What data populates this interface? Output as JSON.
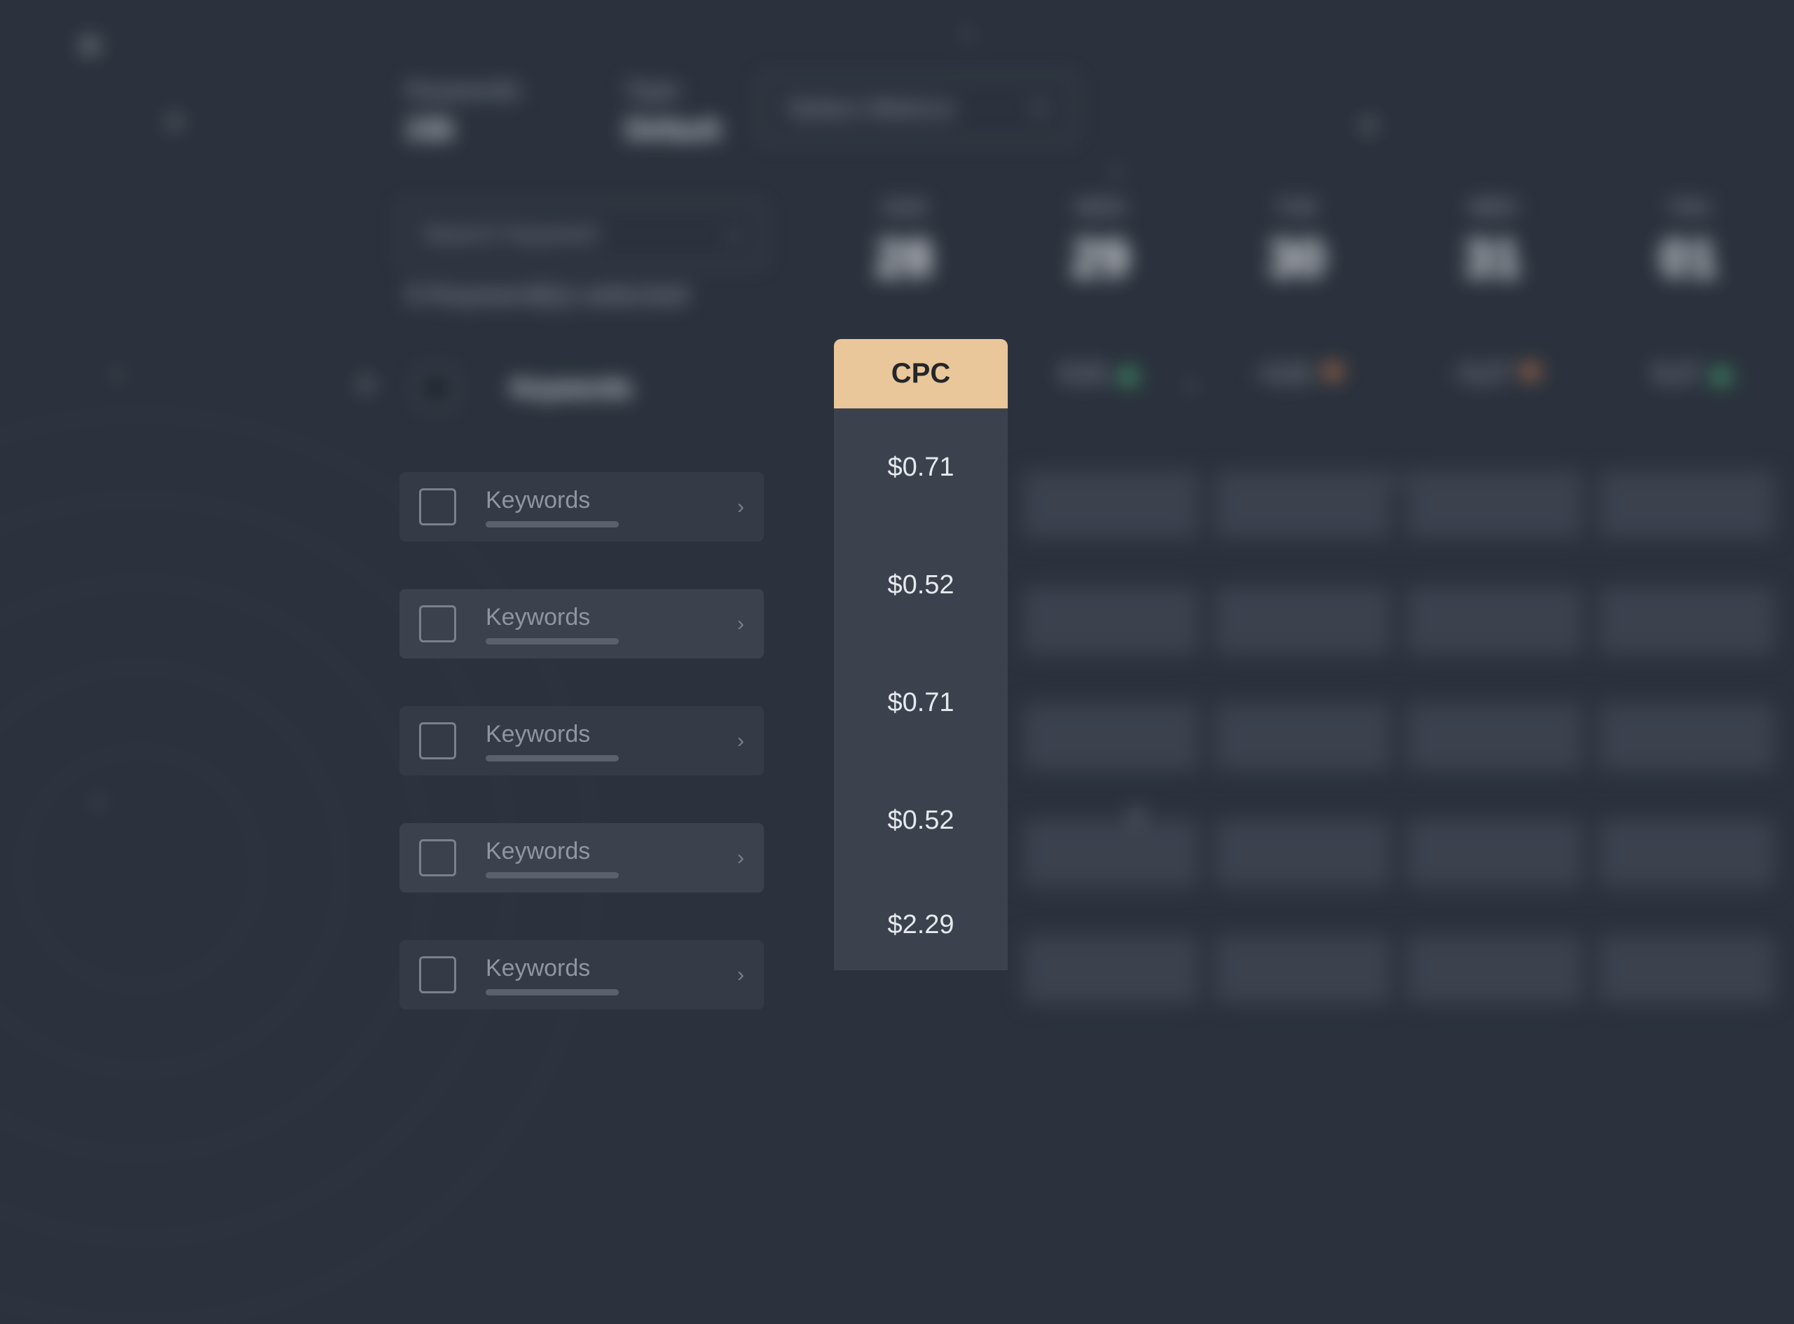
{
  "header": {
    "keywords_label": "Keywords",
    "keywords_value": "236",
    "type_label": "Type",
    "type_value": "Default",
    "metrics_placeholder": "Select Metrics"
  },
  "search": {
    "placeholder": "Search Keyword"
  },
  "selection_text": "0 Keyword(s) selected",
  "column_header": "Keywords",
  "cpc_header": "CPC",
  "dates": [
    {
      "dow": "SUN",
      "num": "28"
    },
    {
      "dow": "MON",
      "num": "29"
    },
    {
      "dow": "TUE",
      "num": "30"
    },
    {
      "dow": "WED",
      "num": "31"
    },
    {
      "dow": "THU",
      "num": "01"
    }
  ],
  "changes": [
    {
      "value": "0,21",
      "dir": "up"
    },
    {
      "value": "- 0,21",
      "dir": "down"
    },
    {
      "value": "- 0,17",
      "dir": "down"
    },
    {
      "value": "0,17",
      "dir": "up"
    }
  ],
  "rows": [
    {
      "label": "Keywords",
      "cpc": "$0.71"
    },
    {
      "label": "Keywords",
      "cpc": "$0.52"
    },
    {
      "label": "Keywords",
      "cpc": "$0.71"
    },
    {
      "label": "Keywords",
      "cpc": "$0.52"
    },
    {
      "label": "Keywords",
      "cpc": "$2.29"
    }
  ]
}
